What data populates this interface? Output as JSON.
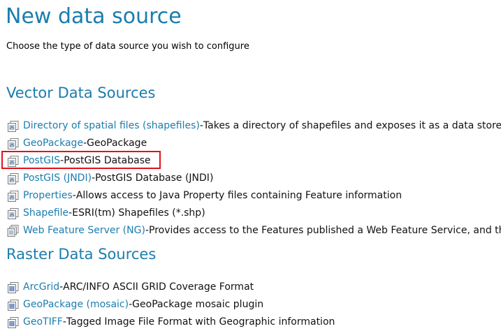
{
  "page": {
    "title": "New data source",
    "subtitle": "Choose the type of data source you wish to configure"
  },
  "vector": {
    "heading": "Vector Data Sources",
    "items": [
      {
        "link": "Directory of spatial files (shapefiles)",
        "sep": " - ",
        "desc": "Takes a directory of shapefiles and exposes it as a data store",
        "icon": "vector-store-icon"
      },
      {
        "link": "GeoPackage",
        "sep": " - ",
        "desc": "GeoPackage",
        "icon": "vector-store-icon"
      },
      {
        "link": "PostGIS",
        "sep": " - ",
        "desc": "PostGIS Database",
        "icon": "vector-store-icon"
      },
      {
        "link": "PostGIS (JNDI)",
        "sep": " - ",
        "desc": "PostGIS Database (JNDI)",
        "icon": "vector-store-icon"
      },
      {
        "link": "Properties",
        "sep": " - ",
        "desc": "Allows access to Java Property files containing Feature information",
        "icon": "vector-store-icon"
      },
      {
        "link": "Shapefile",
        "sep": " - ",
        "desc": "ESRI(tm) Shapefiles (*.shp)",
        "icon": "vector-store-icon"
      },
      {
        "link": "Web Feature Server (NG)",
        "sep": " - ",
        "desc": "Provides access to the Features published a Web Feature Service, and the a",
        "icon": "wfs-store-icon"
      }
    ]
  },
  "raster": {
    "heading": "Raster Data Sources",
    "items": [
      {
        "link": "ArcGrid",
        "sep": " - ",
        "desc": "ARC/INFO ASCII GRID Coverage Format",
        "icon": "raster-store-icon"
      },
      {
        "link": "GeoPackage (mosaic)",
        "sep": " - ",
        "desc": "GeoPackage mosaic plugin",
        "icon": "raster-store-icon"
      },
      {
        "link": "GeoTIFF",
        "sep": " - ",
        "desc": "Tagged Image File Format with Geographic information",
        "icon": "raster-store-icon"
      }
    ]
  },
  "highlight": {
    "color": "#e0121c"
  },
  "colors": {
    "link": "#1b7dad",
    "heading": "#1b7dad"
  }
}
